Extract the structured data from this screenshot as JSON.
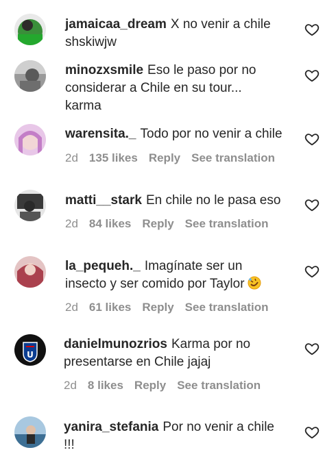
{
  "comments": [
    {
      "username": "jamaicaa_dream",
      "text": "X no venir a chile shskiwjw",
      "avatar_color": "#3a8f3a"
    },
    {
      "username": "minozxsmile",
      "text": "Eso le paso por no considerar a Chile en su tour... karma",
      "avatar_color": "#8a8a8a"
    },
    {
      "username": "warensita._",
      "text": "Todo por no venir a chile",
      "time": "2d",
      "likes": "135 likes",
      "reply": "Reply",
      "translation": "See translation",
      "avatar_color": "#c37ec7"
    },
    {
      "username": "matti__stark",
      "text": "En chile no le pasa eso",
      "time": "2d",
      "likes": "84 likes",
      "reply": "Reply",
      "translation": "See translation",
      "avatar_color": "#4a4a4a"
    },
    {
      "username": "la_pequeh._",
      "text": "Imagínate ser un insecto y ser comido por Taylor",
      "emoji": "rolling-on-floor-laughing-emoji",
      "time": "2d",
      "likes": "61 likes",
      "reply": "Reply",
      "translation": "See translation",
      "avatar_color": "#a02a3a"
    },
    {
      "username": "danielmunozrios",
      "text": "Karma por no presentarse en Chile jajaj",
      "time": "2d",
      "likes": "8 likes",
      "reply": "Reply",
      "translation": "See translation",
      "avatar_color": "#1a1a1a"
    },
    {
      "username": "yanira_stefania",
      "text": "Por no venir a chile !!!",
      "avatar_color": "#6a8fb0"
    }
  ],
  "icons": {
    "like": "heart-outline-icon"
  },
  "colors": {
    "text": "#262626",
    "meta": "#8e8e8e",
    "background": "#ffffff"
  }
}
